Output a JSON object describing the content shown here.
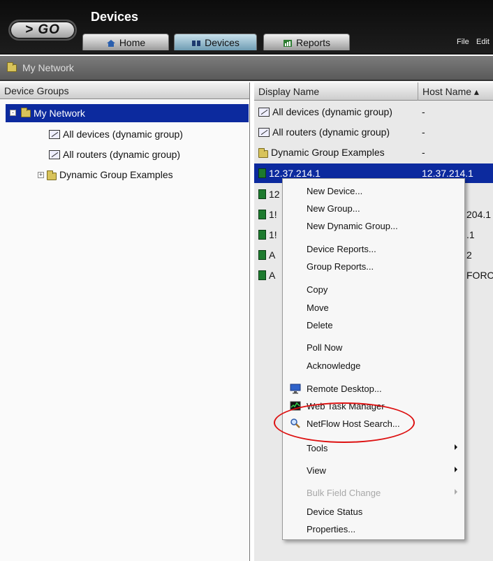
{
  "app": {
    "go_label": "> GO",
    "title": "Devices",
    "tabs": [
      {
        "label": "Home"
      },
      {
        "label": "Devices"
      },
      {
        "label": "Reports"
      }
    ],
    "menus": {
      "file": "File",
      "edit": "Edit"
    }
  },
  "breadcrumb": {
    "label": "My Network"
  },
  "left_panel": {
    "header": "Device Groups",
    "tree": [
      {
        "label": "My Network",
        "expander": "-",
        "selected": true
      },
      {
        "label": "All devices (dynamic group)"
      },
      {
        "label": "All routers (dynamic group)"
      },
      {
        "label": "Dynamic Group Examples",
        "expander": "+"
      }
    ]
  },
  "right_panel": {
    "columns": [
      "Display Name",
      "Host Name ▴"
    ],
    "rows": [
      {
        "display_name": "All devices (dynamic group)",
        "host_name": "-",
        "icon": "dynamic-group-icon"
      },
      {
        "display_name": "All routers (dynamic group)",
        "host_name": "-",
        "icon": "dynamic-group-icon"
      },
      {
        "display_name": "Dynamic Group Examples",
        "host_name": "-",
        "icon": "folder-icon"
      },
      {
        "display_name": "12.37.214.1",
        "host_name": "12.37.214.1",
        "icon": "device-icon",
        "selected": true
      },
      {
        "display_name": "12",
        "host_name": "",
        "icon": "device-icon"
      },
      {
        "display_name": "1!",
        "host_name": "204.1",
        "icon": "device-icon"
      },
      {
        "display_name": "1!",
        "host_name": ".1",
        "icon": "device-icon"
      },
      {
        "display_name": "A",
        "host_name": "2",
        "icon": "device-icon"
      },
      {
        "display_name": "A",
        "host_name": "FORC",
        "icon": "device-icon"
      }
    ]
  },
  "context_menu": {
    "items": [
      {
        "label": "New Device..."
      },
      {
        "label": "New Group..."
      },
      {
        "label": "New Dynamic Group..."
      },
      {
        "label": "Device Reports..."
      },
      {
        "label": "Group Reports..."
      },
      {
        "label": "Copy"
      },
      {
        "label": "Move"
      },
      {
        "label": "Delete"
      },
      {
        "label": "Poll Now"
      },
      {
        "label": "Acknowledge"
      },
      {
        "label": "Remote Desktop...",
        "icon": "remote-desktop-icon"
      },
      {
        "label": "Web Task Manager",
        "icon": "task-manager-icon"
      },
      {
        "label": "NetFlow Host Search...",
        "icon": "magnifier-icon"
      },
      {
        "label": "Tools",
        "submenu": true
      },
      {
        "label": "View",
        "submenu": true
      },
      {
        "label": "Bulk Field Change",
        "submenu": true,
        "disabled": true
      },
      {
        "label": "Device Status"
      },
      {
        "label": "Properties..."
      }
    ]
  },
  "colors": {
    "selection": "#0c2a9e",
    "highlight_ellipse": "#dd1111",
    "device_icon": "#1d7a2e"
  }
}
